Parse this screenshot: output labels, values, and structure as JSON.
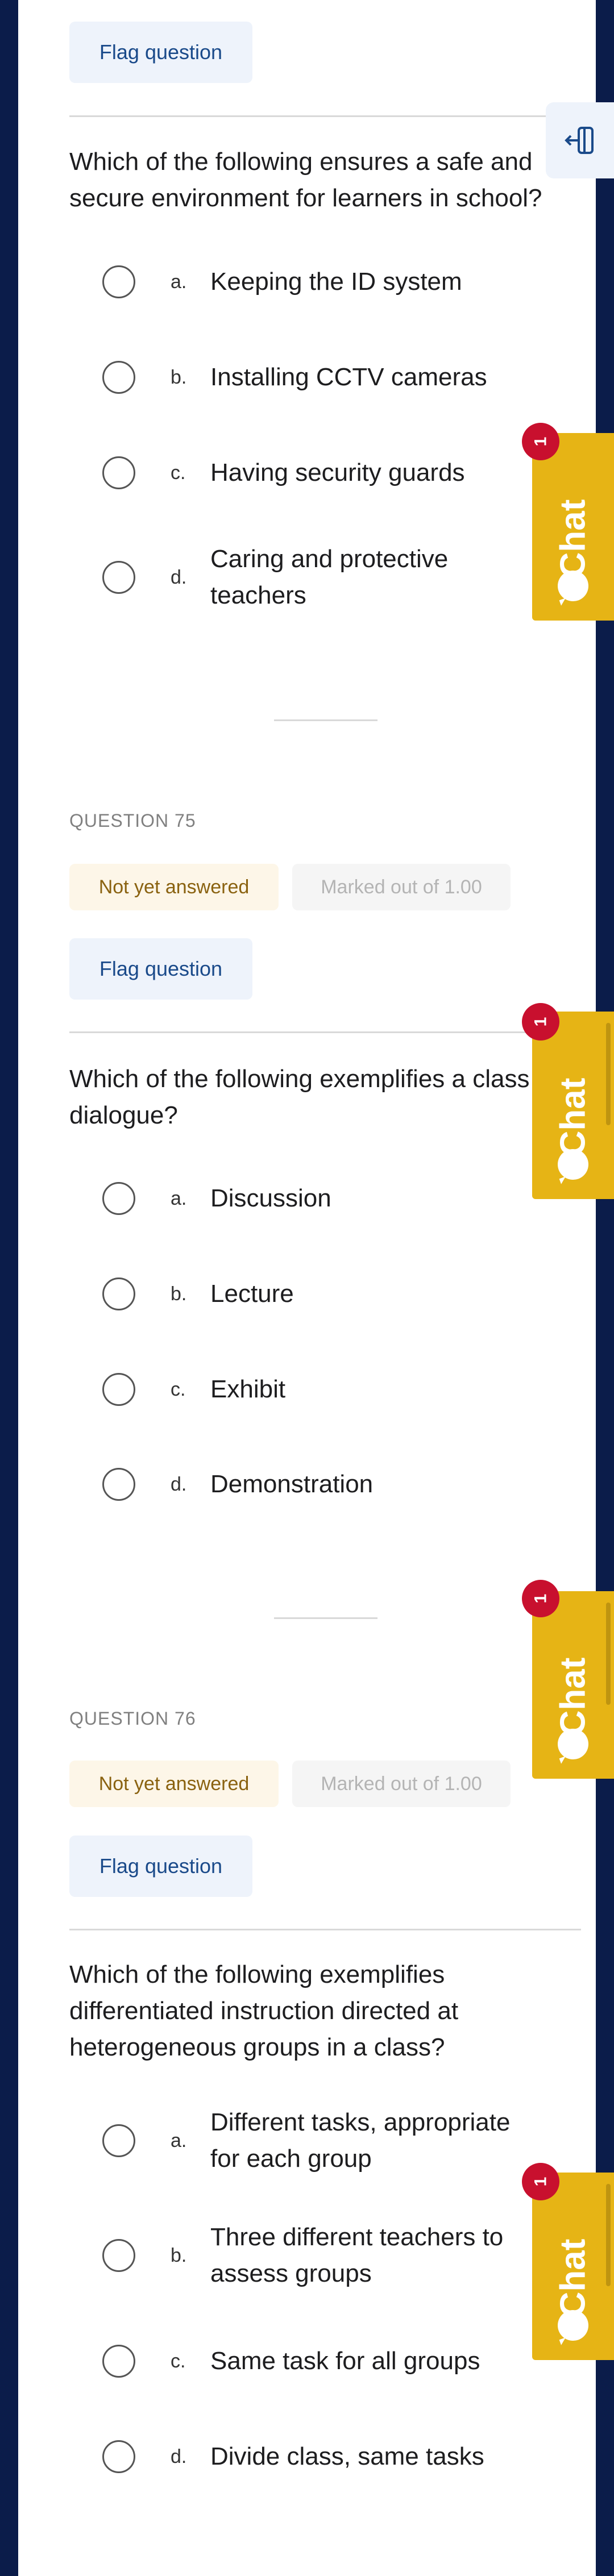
{
  "flag_label": "Flag question",
  "questions": [
    {
      "text": "Which of the following ensures a safe and secure environment for learners in school?",
      "options": [
        {
          "letter": "a.",
          "text": "Keeping the ID system"
        },
        {
          "letter": "b.",
          "text": "Installing CCTV cameras"
        },
        {
          "letter": "c.",
          "text": "Having security guards"
        },
        {
          "letter": "d.",
          "text": "Caring and protective teachers"
        }
      ]
    },
    {
      "number": "QUESTION 75",
      "state": "Not yet answered",
      "marks": "Marked out of 1.00",
      "text_line1": "Which of the following exemplifies a class",
      "text_line2": "dialogue?",
      "options": [
        {
          "letter": "a.",
          "text": "Discussion"
        },
        {
          "letter": "b.",
          "text": "Lecture"
        },
        {
          "letter": "c.",
          "text": "Exhibit"
        },
        {
          "letter": "d.",
          "text": "Demonstration"
        }
      ]
    },
    {
      "number": "QUESTION 76",
      "state": "Not yet answered",
      "marks": "Marked out of 1.00",
      "text": "Which of the following exemplifies differentiated instruction directed at heterogeneous groups in a class?",
      "options": [
        {
          "letter": "a.",
          "text": "Different tasks, appropriate for each group"
        },
        {
          "letter": "b.",
          "text": "Three different teachers to assess groups"
        },
        {
          "letter": "c.",
          "text": "Same task for all groups"
        },
        {
          "letter": "d.",
          "text": "Divide class, same tasks"
        }
      ]
    }
  ],
  "chat": {
    "label": "Chat",
    "notification_count": "1",
    "color": "#e6b415",
    "badge_color": "#c8102e"
  },
  "icons": {
    "drawer": "drawer-toggle-icon",
    "chat": "chat-bubble-icon"
  }
}
